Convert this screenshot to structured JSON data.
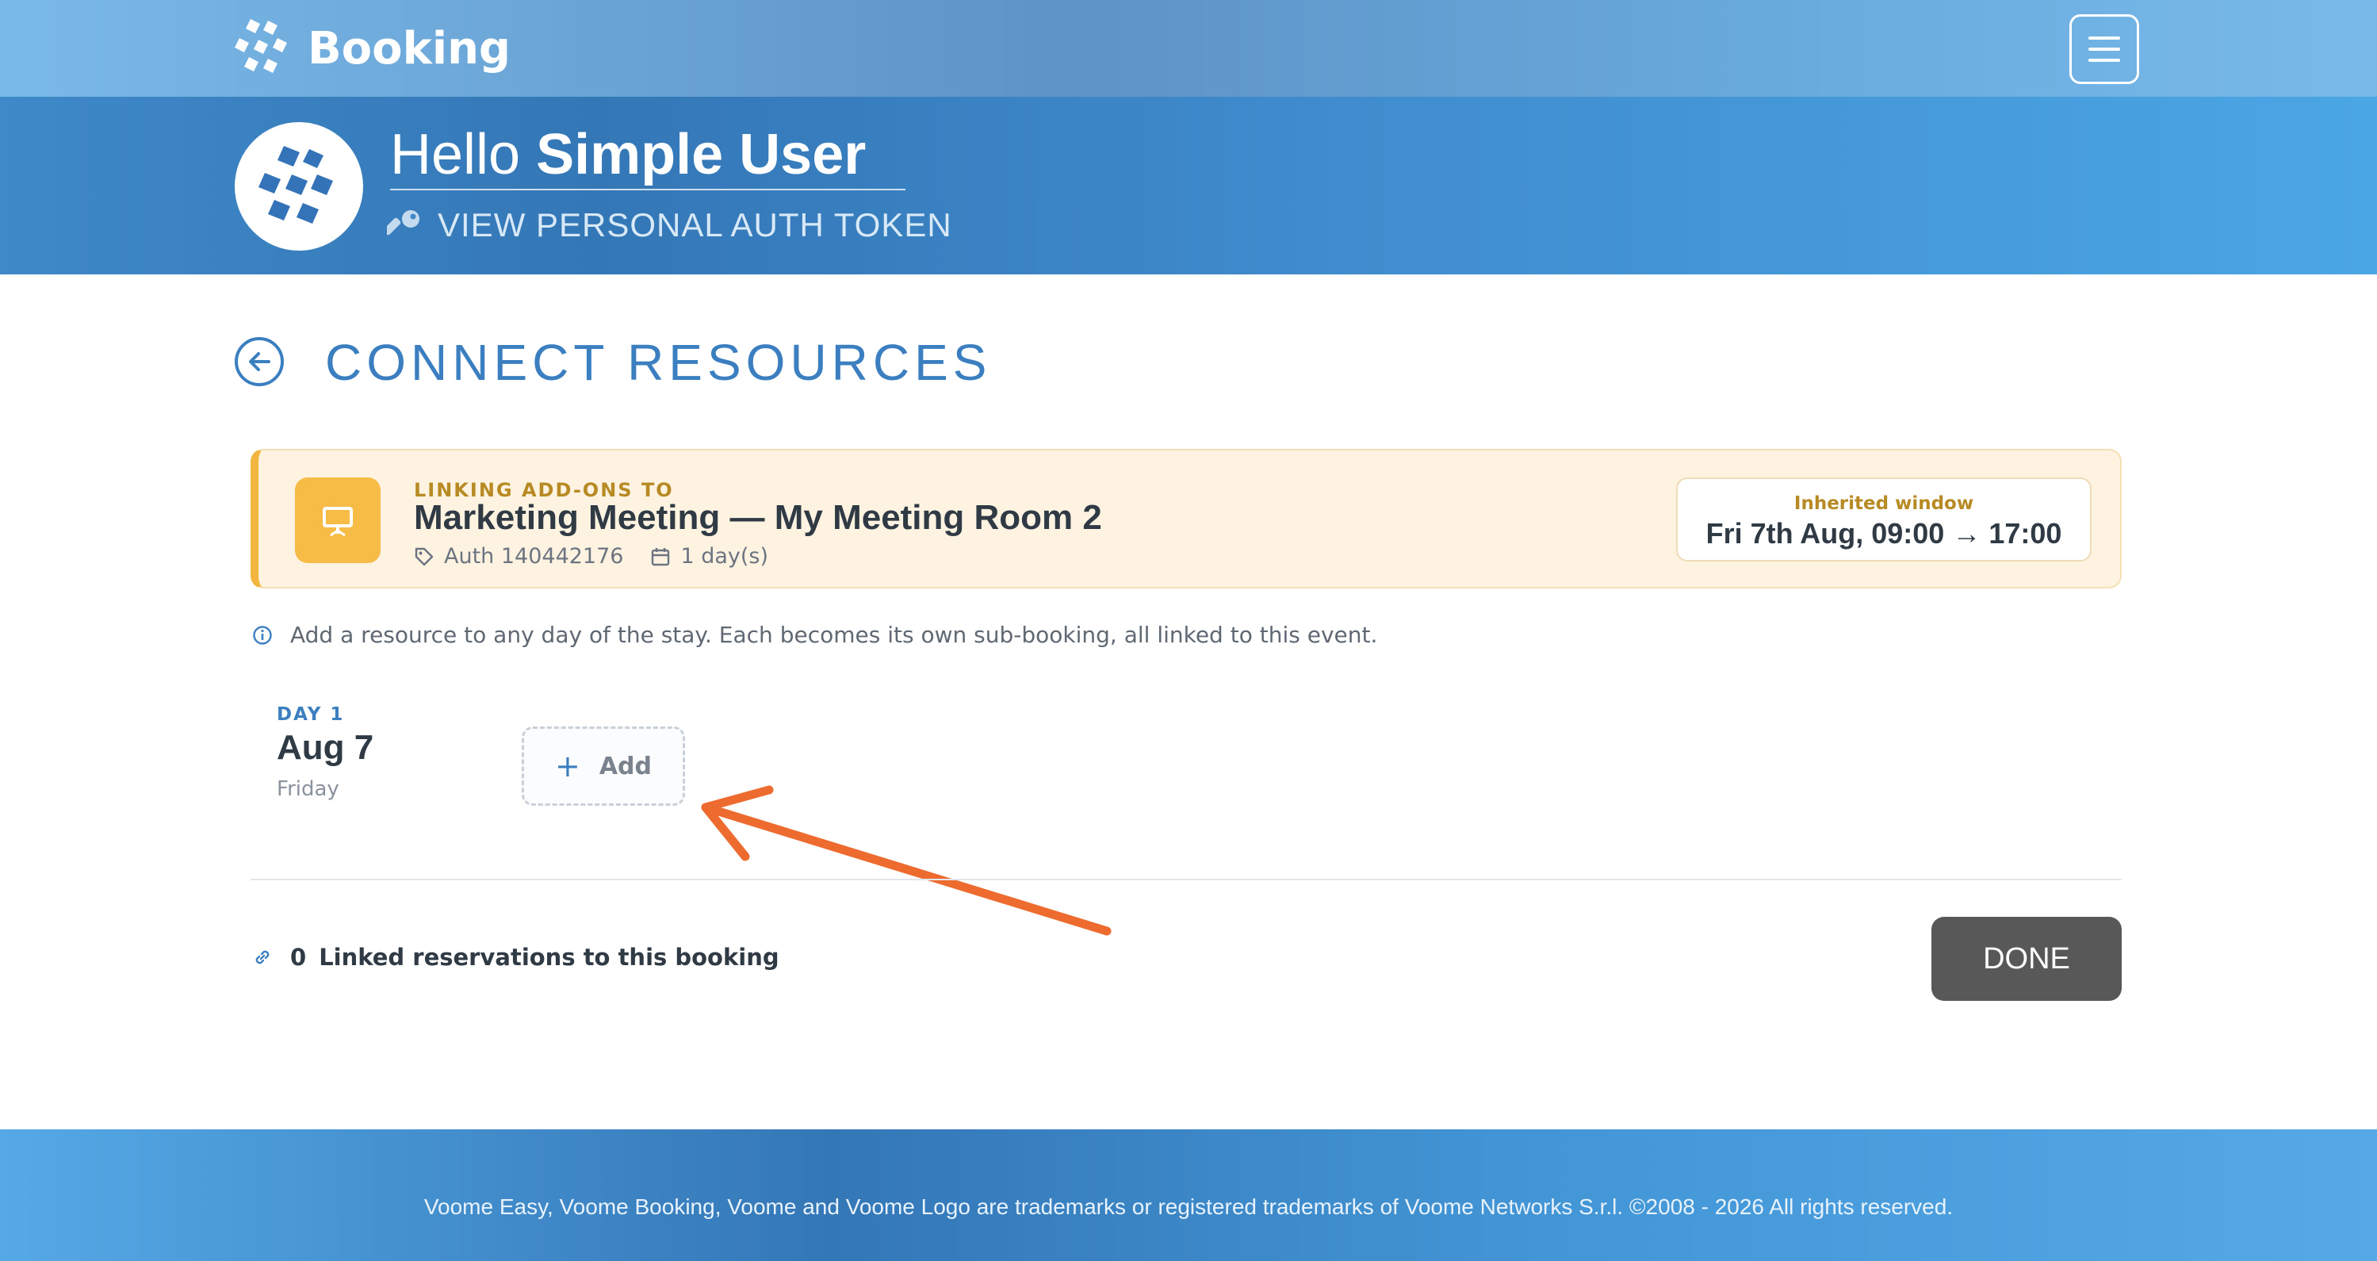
{
  "app": {
    "brand": "Booking"
  },
  "hero": {
    "greeting": "Hello",
    "user_name": "Simple User",
    "token_link": "VIEW PERSONAL AUTH TOKEN"
  },
  "page": {
    "title": "CONNECT RESOURCES"
  },
  "card": {
    "kicker": "LINKING ADD-ONS TO",
    "title": "Marketing Meeting — My Meeting Room 2",
    "auth": "Auth 140442176",
    "duration": "1 day(s)",
    "window_label": "Inherited window",
    "window_value": "Fri 7th Aug, 09:00 → 17:00"
  },
  "hint": "Add a resource to any day of the stay. Each becomes its own sub-booking, all linked to this event.",
  "days": [
    {
      "label": "DAY 1",
      "date": "Aug 7",
      "weekday": "Friday",
      "add_label": "Add"
    }
  ],
  "linked": {
    "count": "0",
    "label": "Linked reservations to this booking"
  },
  "done_label": "DONE",
  "footer": "Voome Easy, Voome Booking, Voome and Voome Logo are trademarks or registered trademarks of Voome Networks S.r.l. ©2008 - 2026 All rights reserved.",
  "colors": {
    "accent_blue": "#3b7fc0",
    "card_accent": "#f2b63f",
    "arrow": "#ee6b2f",
    "done_button": "#585858"
  }
}
